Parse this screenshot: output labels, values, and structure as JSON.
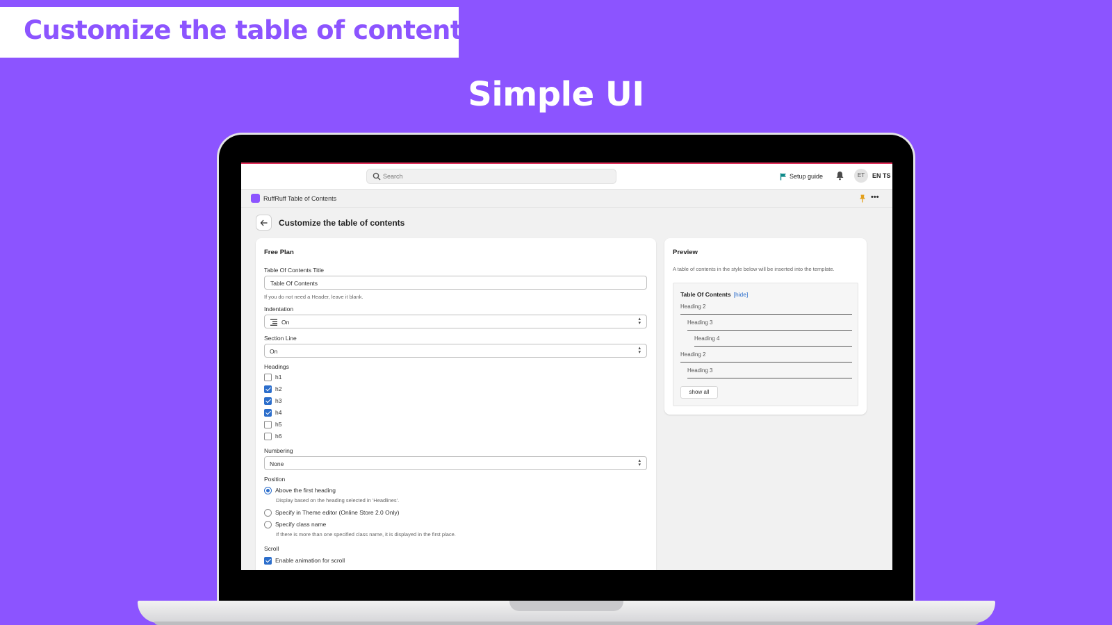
{
  "banner": {
    "title": "Customize the table of contents"
  },
  "hero": {
    "title": "Simple UI"
  },
  "topbar": {
    "search_placeholder": "Search",
    "setup_guide": "Setup guide",
    "avatar_initials": "ET",
    "store_code": "EN TS"
  },
  "appbar": {
    "app_name": "RuffRuff Table of Contents",
    "more": "•••"
  },
  "page": {
    "title": "Customize the table of contents"
  },
  "settings": {
    "plan_title": "Free Plan",
    "toc_title_label": "Table Of Contents Title",
    "toc_title_value": "Table Of Contents",
    "toc_title_help": "If you do not need a Header, leave it blank.",
    "indentation_label": "Indentation",
    "indentation_value": "On",
    "section_line_label": "Section Line",
    "section_line_value": "On",
    "headings_label": "Headings",
    "headings": [
      {
        "label": "h1",
        "checked": false
      },
      {
        "label": "h2",
        "checked": true
      },
      {
        "label": "h3",
        "checked": true
      },
      {
        "label": "h4",
        "checked": true
      },
      {
        "label": "h5",
        "checked": false
      },
      {
        "label": "h6",
        "checked": false
      }
    ],
    "numbering_label": "Numbering",
    "numbering_value": "None",
    "position_label": "Position",
    "position_options": [
      {
        "label": "Above the first heading",
        "selected": true,
        "help": "Display based on the heading selected in 'Headlines'."
      },
      {
        "label": "Specify in Theme editor (Online Store 2.0 Only)",
        "selected": false,
        "help": ""
      },
      {
        "label": "Specify class name",
        "selected": false,
        "help": "If there is more than one specified class name, it is displayed in the first place."
      }
    ],
    "scroll_label": "Scroll",
    "scroll_option": "Enable animation for scroll"
  },
  "preview": {
    "title": "Preview",
    "description": "A table of contents in the style below will be inserted into the template.",
    "toc_title": "Table Of Contents",
    "toc_hide": "[hide]",
    "items": [
      {
        "label": "Heading 2",
        "level": 2
      },
      {
        "label": "Heading 3",
        "level": 3
      },
      {
        "label": "Heading 4",
        "level": 4
      },
      {
        "label": "Heading 2",
        "level": 2
      },
      {
        "label": "Heading 3",
        "level": 3
      }
    ],
    "show_all": "show all"
  },
  "colors": {
    "brand": "#8c54ff",
    "accent": "#2c6ecb",
    "background": "#f1f1f1"
  }
}
